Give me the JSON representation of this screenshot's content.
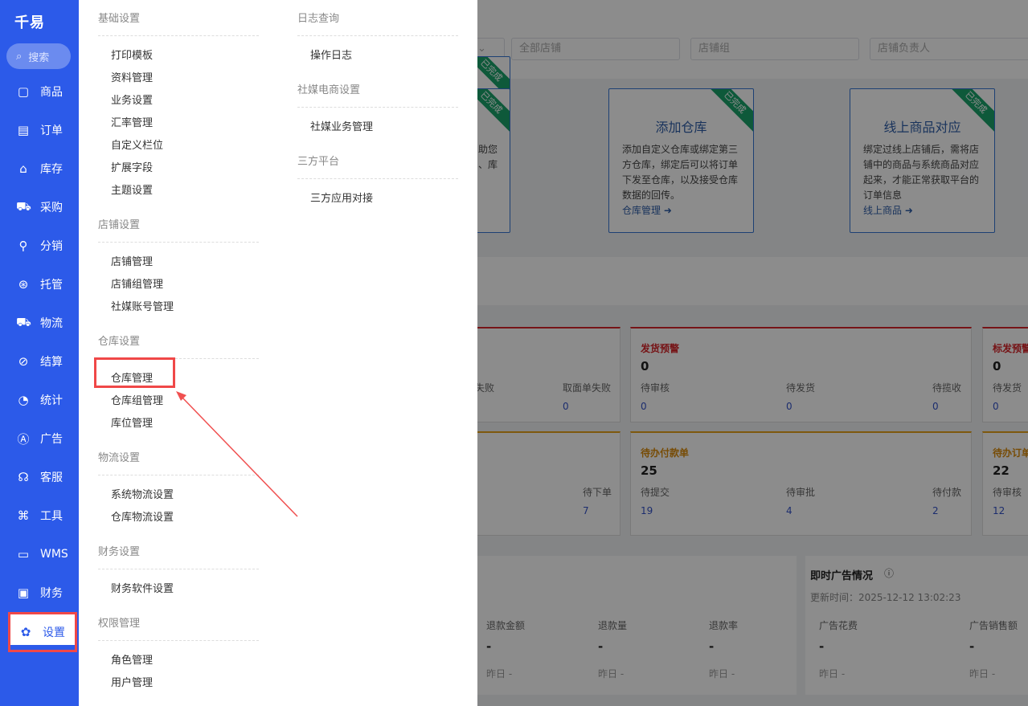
{
  "sidebar": {
    "logo": "千易",
    "search": "搜索",
    "items": [
      {
        "label": "商品",
        "icon": "bag-icon"
      },
      {
        "label": "订单",
        "icon": "document-icon"
      },
      {
        "label": "库存",
        "icon": "warehouse-icon"
      },
      {
        "label": "采购",
        "icon": "cart-icon"
      },
      {
        "label": "分销",
        "icon": "hierarchy-icon"
      },
      {
        "label": "托管",
        "icon": "hosting-icon"
      },
      {
        "label": "物流",
        "icon": "truck-icon"
      },
      {
        "label": "结算",
        "icon": "percent-icon"
      },
      {
        "label": "统计",
        "icon": "pie-icon"
      },
      {
        "label": "广告",
        "icon": "ad-icon"
      },
      {
        "label": "客服",
        "icon": "headset-icon"
      },
      {
        "label": "工具",
        "icon": "command-icon"
      },
      {
        "label": "WMS",
        "icon": "wms-icon"
      },
      {
        "label": "财务",
        "icon": "wallet-icon"
      },
      {
        "label": "设置",
        "icon": "gear-icon"
      }
    ]
  },
  "menu": {
    "col1": [
      {
        "title": "基础设置",
        "items": [
          "打印模板",
          "资料管理",
          "业务设置",
          "汇率管理",
          "自定义栏位",
          "扩展字段",
          "主题设置"
        ]
      },
      {
        "title": "店铺设置",
        "items": [
          "店铺管理",
          "店铺组管理",
          "社媒账号管理"
        ]
      },
      {
        "title": "仓库设置",
        "items": [
          "仓库管理",
          "仓库组管理",
          "库位管理"
        ]
      },
      {
        "title": "物流设置",
        "items": [
          "系统物流设置",
          "仓库物流设置"
        ]
      },
      {
        "title": "财务设置",
        "items": [
          "财务软件设置"
        ]
      },
      {
        "title": "权限管理",
        "items": [
          "角色管理",
          "用户管理"
        ]
      }
    ],
    "col2": [
      {
        "title": "日志查询",
        "items": [
          "操作日志"
        ]
      },
      {
        "title": "社媒电商设置",
        "items": [
          "社媒业务管理"
        ]
      },
      {
        "title": "三方平台",
        "items": [
          "三方应用对接"
        ]
      }
    ]
  },
  "filters": {
    "shop": "全部店铺",
    "shop_group": "店铺组",
    "owner": "店铺负责人"
  },
  "cards": [
    {
      "partial_text": "助您\n、库",
      "ribbon": "已完成"
    },
    {
      "title": "添加仓库",
      "desc": "添加自定义仓库或绑定第三方仓库，绑定后可以将订单下发至仓库，以及接受仓库数据的回传。",
      "link": "仓库管理",
      "ribbon": "已完成"
    },
    {
      "title": "线上商品对应",
      "desc": "绑定过线上店铺后，需将店铺中的商品与系统商品对应起来，才能正常获取平台的订单信息",
      "link": "线上商品",
      "ribbon": "已完成"
    }
  ],
  "panels": {
    "p1": {
      "labels": [
        "失败",
        "取面单失败"
      ],
      "values": [
        "0"
      ]
    },
    "p2": {
      "title": "发货预警",
      "count": "0",
      "labels": [
        "待审核",
        "待发货",
        "待揽收"
      ],
      "values": [
        "0",
        "0",
        "0"
      ]
    },
    "p3": {
      "title": "标发预警",
      "count": "0",
      "labels": [
        "待发货"
      ],
      "values": [
        "0"
      ]
    },
    "p4": {
      "labels": [
        "待下单"
      ],
      "values": [
        "7"
      ]
    },
    "p5": {
      "title": "待办付款单",
      "count": "25",
      "labels": [
        "待提交",
        "待审批",
        "待付款"
      ],
      "values": [
        "19",
        "4",
        "2"
      ]
    },
    "p6": {
      "title": "待办订单",
      "count": "22",
      "labels": [
        "待审核"
      ],
      "values": [
        "12"
      ]
    },
    "refund": {
      "labels": [
        "退款金额",
        "退款量",
        "退款率"
      ],
      "values": [
        "-",
        "-",
        "-"
      ],
      "yesterday": [
        "昨日 -",
        "昨日 -",
        "昨日 -"
      ]
    },
    "ads": {
      "title": "即时广告情况",
      "updated": "更新时间：2025-12-12 13:02:23",
      "labels": [
        "广告花费",
        "广告销售额"
      ],
      "values": [
        "-",
        "-"
      ],
      "yesterday": [
        "昨日 -",
        "昨日 -"
      ]
    }
  }
}
